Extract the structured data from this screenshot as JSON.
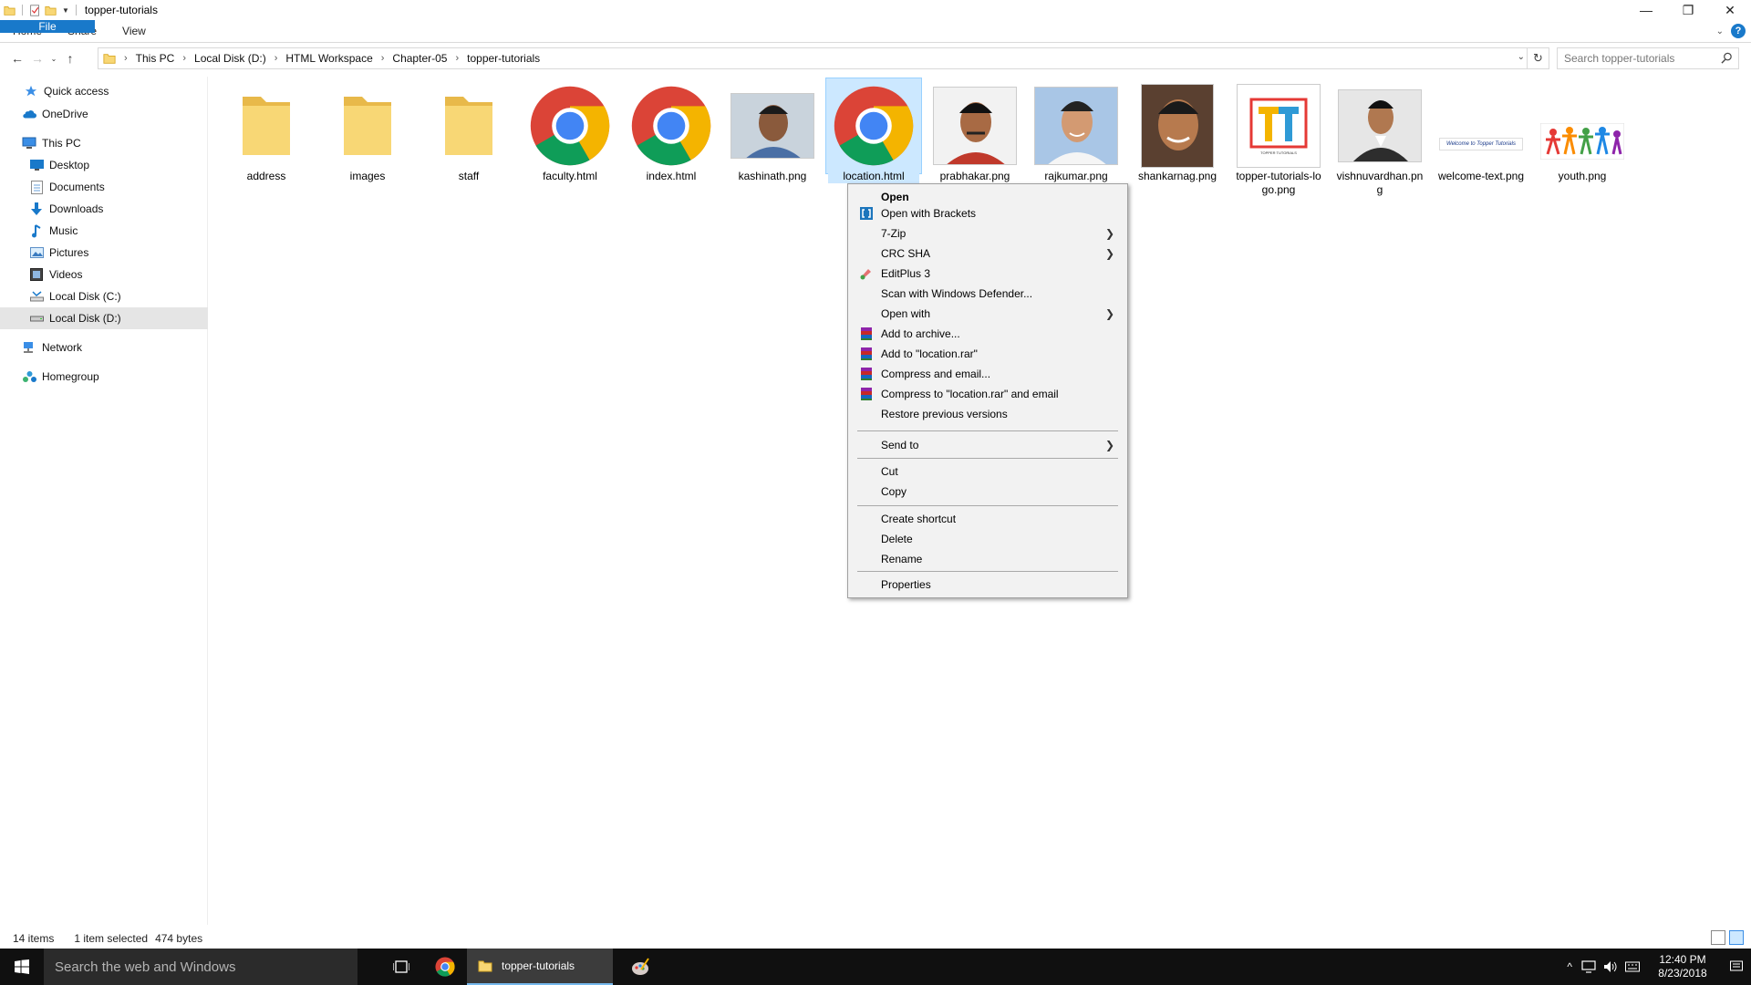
{
  "window": {
    "title": "topper-tutorials"
  },
  "ribbon": {
    "tabs": [
      "File",
      "Home",
      "Share",
      "View"
    ]
  },
  "address": {
    "crumbs": [
      "This PC",
      "Local Disk (D:)",
      "HTML Workspace",
      "Chapter-05",
      "topper-tutorials"
    ],
    "search_placeholder": "Search topper-tutorials"
  },
  "nav": {
    "items": [
      {
        "label": "Quick access",
        "icon": "star-icon"
      },
      {
        "label": "OneDrive",
        "icon": "cloud-icon"
      },
      {
        "label": "This PC",
        "icon": "computer-icon"
      },
      {
        "label": "Desktop",
        "icon": "desktop-icon"
      },
      {
        "label": "Documents",
        "icon": "documents-icon"
      },
      {
        "label": "Downloads",
        "icon": "downloads-icon"
      },
      {
        "label": "Music",
        "icon": "music-icon"
      },
      {
        "label": "Pictures",
        "icon": "pictures-icon"
      },
      {
        "label": "Videos",
        "icon": "videos-icon"
      },
      {
        "label": "Local Disk (C:)",
        "icon": "drive-icon"
      },
      {
        "label": "Local Disk (D:)",
        "icon": "drive-icon",
        "selected": true
      },
      {
        "label": "Network",
        "icon": "network-icon"
      },
      {
        "label": "Homegroup",
        "icon": "homegroup-icon"
      }
    ]
  },
  "files": [
    {
      "name": "address",
      "type": "folder"
    },
    {
      "name": "images",
      "type": "folder"
    },
    {
      "name": "staff",
      "type": "folder"
    },
    {
      "name": "faculty.html",
      "type": "chrome"
    },
    {
      "name": "index.html",
      "type": "chrome"
    },
    {
      "name": "kashinath.png",
      "type": "photo"
    },
    {
      "name": "location.html",
      "type": "chrome",
      "selected": true
    },
    {
      "name": "prabhakar.png",
      "type": "photo"
    },
    {
      "name": "rajkumar.png",
      "type": "photo"
    },
    {
      "name": "shankarnag.png",
      "type": "photo"
    },
    {
      "name": "topper-tutorials-logo.png",
      "type": "logo"
    },
    {
      "name": "vishnuvardhan.png",
      "type": "photo"
    },
    {
      "name": "welcome-text.png",
      "type": "banner"
    },
    {
      "name": "youth.png",
      "type": "youth"
    }
  ],
  "thumb_text": {
    "logo_caption": "TOPPER TUTORIALS",
    "banner_caption": "Welcome to Topper Tutorials"
  },
  "context_menu": {
    "items": [
      {
        "label": "Open",
        "bold": true
      },
      {
        "label": "Open with Brackets",
        "icon": "brackets-icon"
      },
      {
        "label": "7-Zip",
        "submenu": true
      },
      {
        "label": "CRC SHA",
        "submenu": true
      },
      {
        "label": "EditPlus 3",
        "icon": "editplus-icon"
      },
      {
        "label": "Scan with Windows Defender..."
      },
      {
        "label": "Open with",
        "submenu": true
      },
      {
        "label": "Add to archive...",
        "icon": "winrar-icon"
      },
      {
        "label": "Add to \"location.rar\"",
        "icon": "winrar-icon"
      },
      {
        "label": "Compress and email...",
        "icon": "winrar-icon"
      },
      {
        "label": "Compress to \"location.rar\" and email",
        "icon": "winrar-icon"
      },
      {
        "label": "Restore previous versions"
      },
      {
        "label": "Send to",
        "submenu": true
      },
      {
        "label": "Cut"
      },
      {
        "label": "Copy"
      },
      {
        "label": "Create shortcut"
      },
      {
        "label": "Delete"
      },
      {
        "label": "Rename"
      },
      {
        "label": "Properties"
      }
    ]
  },
  "status": {
    "item_count": "14 items",
    "selection": "1 item selected",
    "size": "474 bytes"
  },
  "taskbar": {
    "search_placeholder": "Search the web and Windows",
    "explorer_label": "topper-tutorials",
    "time": "12:40 PM",
    "date": "8/23/2018"
  },
  "colors": {
    "accent": "#1979ca",
    "selection": "#cce8ff",
    "folder": "#f8d775",
    "taskbar": "#101010"
  }
}
